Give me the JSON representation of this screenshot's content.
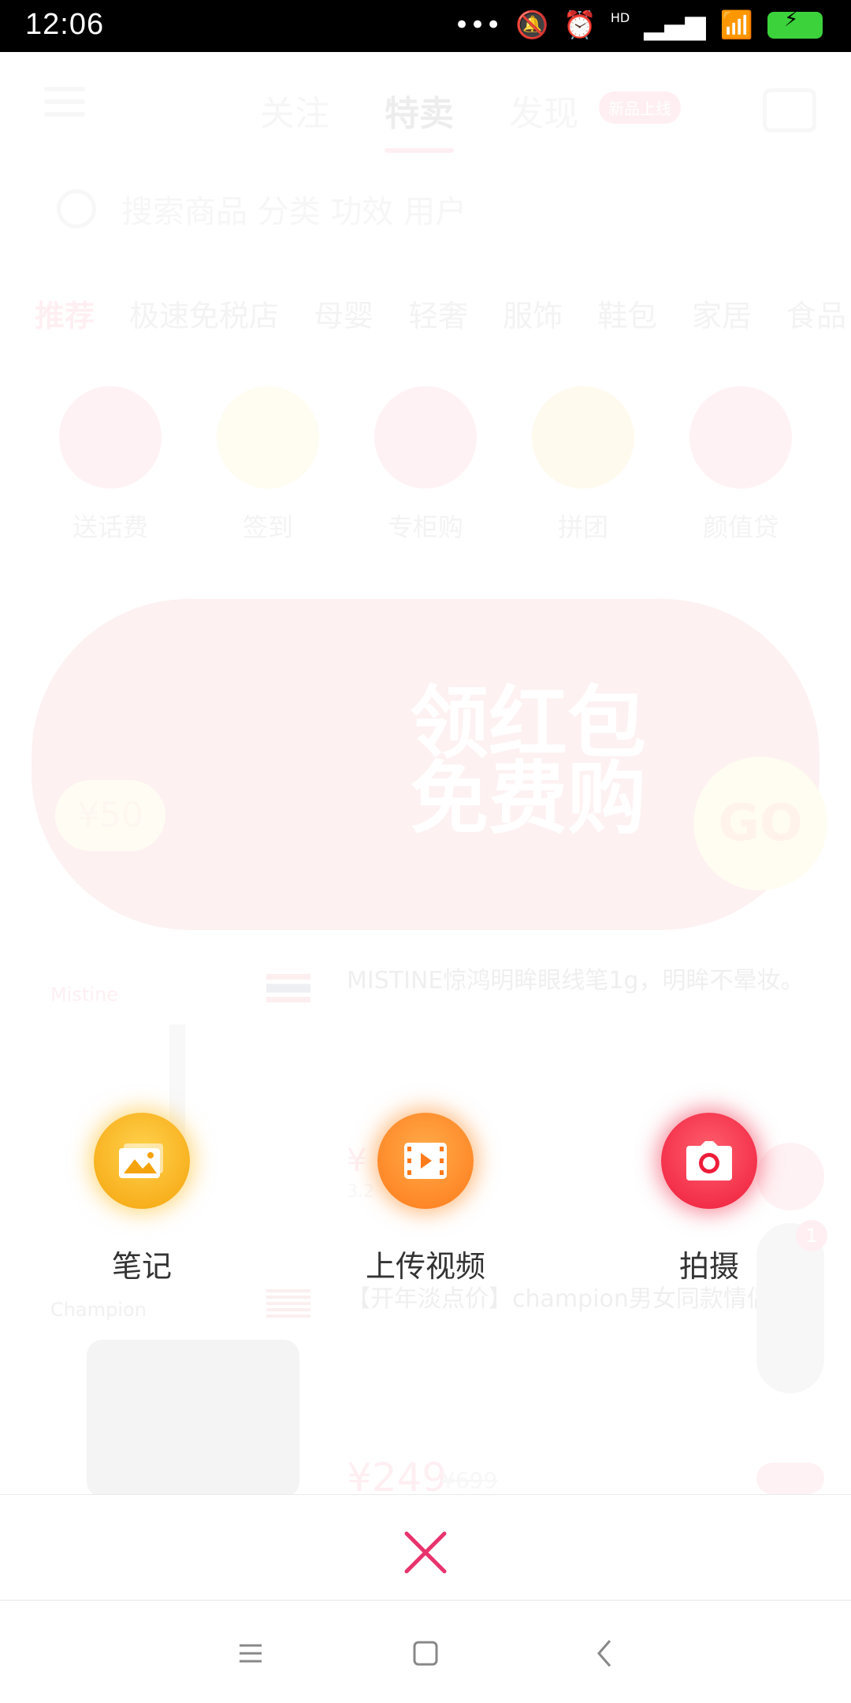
{
  "status_bar": {
    "time": "12:06",
    "icons": [
      "more-dots-icon",
      "bell-muted-icon",
      "alarm-icon",
      "hd-signal-icon",
      "wifi-icon",
      "battery-charging-icon"
    ],
    "hd_label": "HD"
  },
  "header": {
    "tabs": [
      {
        "label": "关注"
      },
      {
        "label": "特卖"
      },
      {
        "label": "发现"
      }
    ],
    "discover_badge": "新品上线"
  },
  "search": {
    "placeholder": "搜索商品 分类 功效 用户"
  },
  "categories": [
    "推荐",
    "极速免税店",
    "母婴",
    "轻奢",
    "服饰",
    "鞋包",
    "家居",
    "食品"
  ],
  "quick_entries": [
    {
      "label": "送话费",
      "color": "#ff5a6e"
    },
    {
      "label": "签到",
      "color": "#ffd24d"
    },
    {
      "label": "专柜购",
      "color": "#ff5a6e"
    },
    {
      "label": "拼团",
      "color": "#ffc22e"
    },
    {
      "label": "颜值贷",
      "color": "#ff5a6e"
    }
  ],
  "banner": {
    "line1": "领红包",
    "line2": "免费购",
    "go": "GO",
    "coupon": "¥50"
  },
  "products": [
    {
      "brand": "Mistine",
      "title": "MISTINE惊鸿明眸眼线笔1g，明眸不晕妆。",
      "price": "¥",
      "sub": "3.2"
    },
    {
      "brand": "Champion",
      "title": "【开年淡点价】champion男女同款情侣T恤",
      "price": "¥249",
      "original_price": "¥699"
    }
  ],
  "float_badge": "1",
  "actions": [
    {
      "label": "笔记",
      "icon": "image-icon",
      "color": "#f5a30c"
    },
    {
      "label": "上传视频",
      "icon": "film-icon",
      "color": "#ff7a1a"
    },
    {
      "label": "拍摄",
      "icon": "camera-icon",
      "color": "#ee1c3a"
    }
  ],
  "close": {
    "icon": "close-icon",
    "color": "#e8336d"
  },
  "nav": [
    "menu-icon",
    "home-icon",
    "back-icon"
  ]
}
